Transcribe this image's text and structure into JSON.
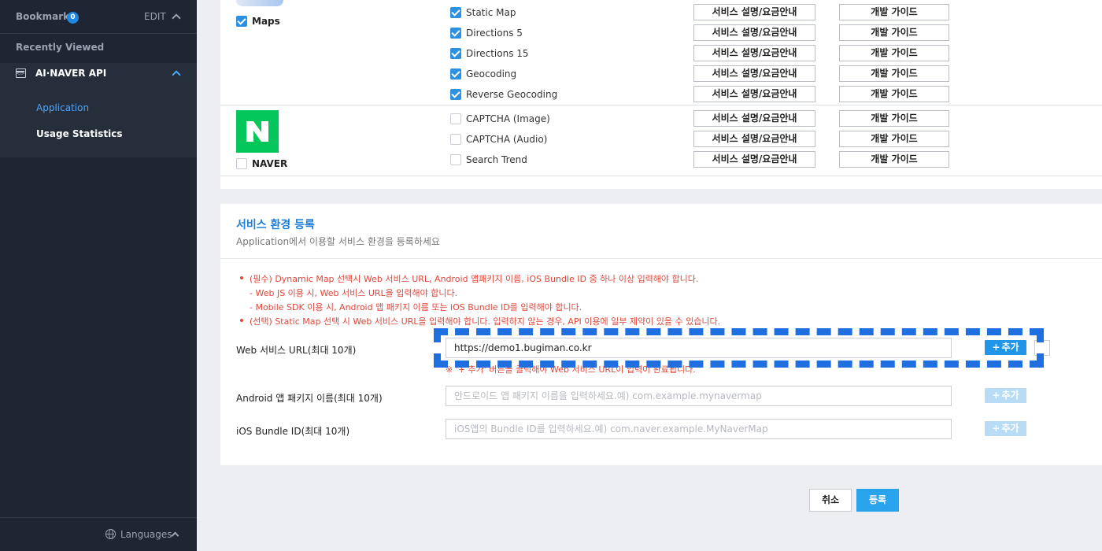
{
  "sidebar": {
    "bookmarks_label": "Bookmarks",
    "bookmarks_count": "0",
    "edit_label": "EDIT",
    "recently_viewed": "Recently Viewed",
    "product_name": "AI·NAVER API",
    "sub_items": [
      "Application",
      "Usage Statistics"
    ],
    "languages_label": "Languages"
  },
  "providers": [
    {
      "name": "Maps",
      "checked": true
    },
    {
      "name": "NAVER",
      "checked": false
    }
  ],
  "apis": [
    {
      "name": "Static Map",
      "checked": true,
      "service_btn": "서비스 설명/요금안내",
      "guide_btn": "개발 가이드"
    },
    {
      "name": "Directions 5",
      "checked": true,
      "service_btn": "서비스 설명/요금안내",
      "guide_btn": "개발 가이드"
    },
    {
      "name": "Directions 15",
      "checked": true,
      "service_btn": "서비스 설명/요금안내",
      "guide_btn": "개발 가이드"
    },
    {
      "name": "Geocoding",
      "checked": true,
      "service_btn": "서비스 설명/요금안내",
      "guide_btn": "개발 가이드"
    },
    {
      "name": "Reverse Geocoding",
      "checked": true,
      "service_btn": "서비스 설명/요금안내",
      "guide_btn": "개발 가이드"
    },
    {
      "name": "CAPTCHA (Image)",
      "checked": false,
      "service_btn": "서비스 설명/요금안내",
      "guide_btn": "개발 가이드"
    },
    {
      "name": "CAPTCHA (Audio)",
      "checked": false,
      "service_btn": "서비스 설명/요금안내",
      "guide_btn": "개발 가이드"
    },
    {
      "name": "Search Trend",
      "checked": false,
      "service_btn": "서비스 설명/요금안내",
      "guide_btn": "개발 가이드"
    }
  ],
  "env": {
    "title": "서비스 환경 등록",
    "subtitle": "Application에서 이용할 서비스 환경을 등록하세요",
    "notes": [
      "(필수) Dynamic Map 선택시 Web 서비스 URL, Android 앱패키지 이름, iOS Bundle ID 중 하나 이상 입력해야 합니다.",
      "- Web JS 이용 시, Web 서비스 URL을 입력해야 합니다.",
      "- Mobile SDK 이용 시, Android 앱 패키지 이름 또는 iOS Bundle ID를 입력해야 합니다.",
      "(선택) Static Map 선택 시 Web 서비스 URL을 입력해야 합니다. 입력하지 않는 경우, API 이용에 일부 제약이 있을 수 있습니다."
    ],
    "hint": "※ '+ 추가' 버튼을 클릭해야 Web 서비스 URL이 입력이 완료됩니다.",
    "fields": [
      {
        "label": "Web 서비스 URL(최대 10개)",
        "value": "https://demo1.bugiman.co.kr",
        "placeholder": "",
        "add": "추가"
      },
      {
        "label": "Android 앱 패키지 이름(최대 10개)",
        "value": "",
        "placeholder": "안드로이드 앱 패키지 이름을 입력하세요.예) com.example.mynavermap",
        "add": "추가"
      },
      {
        "label": "iOS Bundle ID(최대 10개)",
        "value": "",
        "placeholder": "iOS앱의 Bundle ID를 입력하세요.예) com.naver.example.MyNaverMap",
        "add": "추가"
      }
    ]
  },
  "actions": {
    "cancel": "취소",
    "submit": "등록"
  },
  "colors": {
    "sidebar_bg": "#1f2532",
    "accent": "#1e7fd8",
    "checkbox": "#2c91e0",
    "naver_green": "#03c75a",
    "warning": "#e0463a",
    "highlight_dash": "#1f6fe0"
  }
}
